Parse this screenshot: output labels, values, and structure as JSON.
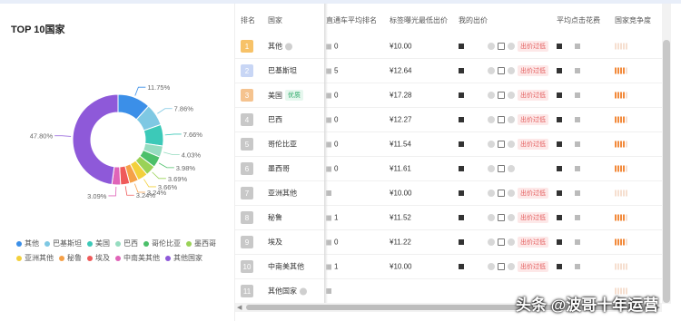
{
  "left": {
    "title": "TOP 10国家"
  },
  "chart_data": {
    "type": "pie",
    "title": "",
    "categories": [
      "其他",
      "巴基斯坦",
      "美国",
      "巴西",
      "哥伦比亚",
      "墨西哥",
      "亚洲其他",
      "秘鲁",
      "埃及",
      "中南美其他",
      "其他国家"
    ],
    "values": [
      11.75,
      7.86,
      7.66,
      4.03,
      3.98,
      3.69,
      3.66,
      3.24,
      3.24,
      3.09,
      47.8
    ],
    "labels": [
      "11.75%",
      "7.86%",
      "7.66%",
      "4.03%",
      "3.98%",
      "3.69%",
      "3.66%",
      "3.24%",
      "3.24%",
      "3.09%",
      "47.80%"
    ],
    "colors": [
      "#3b8fe8",
      "#7ec8e3",
      "#3cc9b8",
      "#96dcc0",
      "#4cc06a",
      "#9ad257",
      "#f3d03c",
      "#f5a047",
      "#ef5a5a",
      "#e064b8",
      "#8e59d9"
    ],
    "legend_position": "bottom"
  },
  "table": {
    "headers": [
      "排名",
      "国家",
      "直通车平均排名",
      "标签曝光最低出价",
      "我的出价",
      "平均点击花费",
      "国家竞争度"
    ],
    "rows": [
      {
        "rank": "1",
        "country": "其他",
        "avg_rank": "0",
        "min_bid": "¥10.00",
        "low_bid": "出价过低",
        "competition": 0
      },
      {
        "rank": "2",
        "country": "巴基斯坦",
        "avg_rank": "5",
        "min_bid": "¥12.64",
        "low_bid": "出价过低",
        "competition": 4
      },
      {
        "rank": "3",
        "country": "美国",
        "badge": "优质",
        "avg_rank": "0",
        "min_bid": "¥17.28",
        "low_bid": "出价过低",
        "competition": 4
      },
      {
        "rank": "4",
        "country": "巴西",
        "avg_rank": "0",
        "min_bid": "¥12.27",
        "low_bid": "出价过低",
        "competition": 4
      },
      {
        "rank": "5",
        "country": "哥伦比亚",
        "avg_rank": "0",
        "min_bid": "¥11.54",
        "low_bid": "出价过低",
        "competition": 4
      },
      {
        "rank": "6",
        "country": "墨西哥",
        "avg_rank": "0",
        "min_bid": "¥11.61",
        "low_bid": "",
        "competition": 4
      },
      {
        "rank": "7",
        "country": "亚洲其他",
        "avg_rank": "",
        "min_bid": "¥10.00",
        "low_bid": "出价过低",
        "competition": 0
      },
      {
        "rank": "8",
        "country": "秘鲁",
        "avg_rank": "1",
        "min_bid": "¥11.52",
        "low_bid": "出价过低",
        "competition": 4
      },
      {
        "rank": "9",
        "country": "埃及",
        "avg_rank": "0",
        "min_bid": "¥11.22",
        "low_bid": "出价过低",
        "competition": 4
      },
      {
        "rank": "10",
        "country": "中南美其他",
        "avg_rank": "1",
        "min_bid": "¥10.00",
        "low_bid": "出价过低",
        "competition": 0
      },
      {
        "rank": "11",
        "country": "其他国家",
        "avg_rank": "",
        "min_bid": "",
        "low_bid": "",
        "competition": 0
      }
    ]
  },
  "watermark": "头条 @波哥十年运营"
}
